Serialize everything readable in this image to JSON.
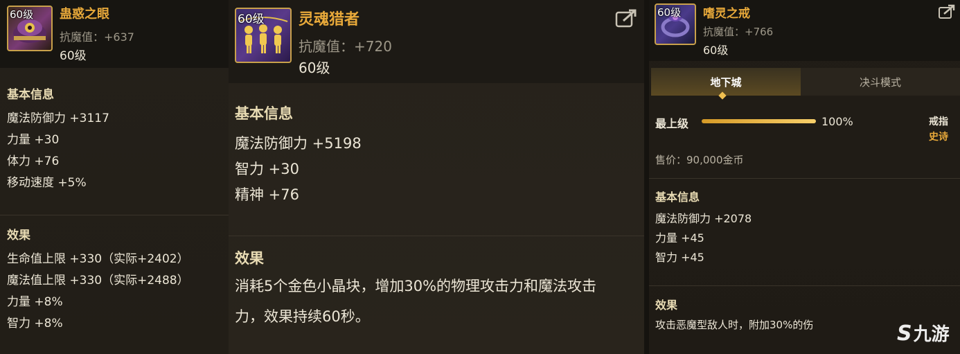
{
  "panel_left": {
    "level_tag": "60级",
    "name": "蛊惑之眼",
    "magic_resist": "抗魔值：+637",
    "level": "60级",
    "basic_title": "基本信息",
    "basic_stats": [
      "魔法防御力 +3117",
      "力量 +30",
      "体力 +76",
      "移动速度 +5%"
    ],
    "effect_title": "效果",
    "effect_stats": [
      "生命值上限 +330（实际+2402）",
      "魔法值上限 +330（实际+2488）",
      "力量 +8%",
      "智力 +8%"
    ]
  },
  "panel_middle": {
    "level_tag": "60级",
    "name": "灵魂猎者",
    "magic_resist": "抗魔值：+720",
    "level": "60级",
    "share_icon": "share-icon",
    "basic_title": "基本信息",
    "basic_stats": [
      "魔法防御力 +5198",
      "智力 +30",
      "精神 +76"
    ],
    "effect_title": "效果",
    "effect_lines": [
      "消耗5个金色小晶块，增加30%的物理攻击力和魔法攻击",
      "力，效果持续60秒。"
    ]
  },
  "panel_right": {
    "level_tag": "60级",
    "name": "嗜灵之戒",
    "magic_resist": "抗魔值：+766",
    "level": "60级",
    "share_icon": "share-icon",
    "tabs": [
      "地下城",
      "决斗模式"
    ],
    "active_tab": 0,
    "upgrade_label": "最上级",
    "upgrade_percent": "100%",
    "upgrade_progress": 1.0,
    "slot_type": "戒指",
    "rarity": "史诗",
    "price": "售价：90,000金币",
    "basic_title": "基本信息",
    "basic_stats": [
      "魔法防御力 +2078",
      "力量 +45",
      "智力 +45"
    ],
    "effect_title": "效果",
    "effect_text": "攻击恶魔型敌人时，附加30%的伤"
  },
  "watermark": {
    "text": "九游"
  },
  "colors": {
    "item_name": "#e8a93a",
    "rarity": "#e8a93a",
    "bar": "#f0c050"
  }
}
